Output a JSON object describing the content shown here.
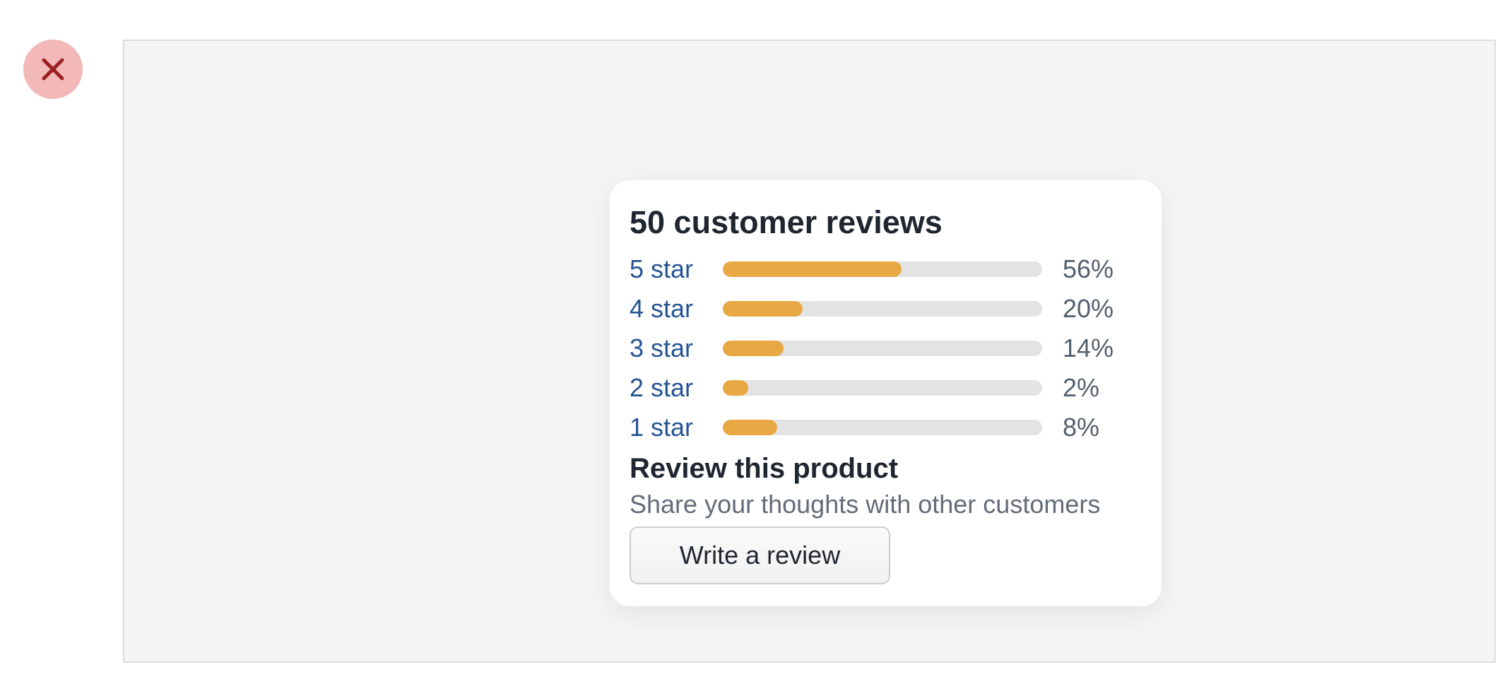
{
  "close_button": {
    "icon": "close-icon"
  },
  "reviews": {
    "title": "50 customer reviews",
    "bar_color": "#e8a843",
    "track_color": "#e3e3e3",
    "link_color": "#255494",
    "ratings": [
      {
        "label": "5 star",
        "percent_text": "56%",
        "fraction": 0.56
      },
      {
        "label": "4 star",
        "percent_text": "20%",
        "fraction": 0.25
      },
      {
        "label": "3 star",
        "percent_text": "14%",
        "fraction": 0.19
      },
      {
        "label": "2 star",
        "percent_text": "2%",
        "fraction": 0.08
      },
      {
        "label": "1 star",
        "percent_text": "8%",
        "fraction": 0.17
      }
    ]
  },
  "review_product": {
    "heading": "Review this product",
    "description": "Share your thoughts with other customers",
    "button_label": "Write a review"
  }
}
